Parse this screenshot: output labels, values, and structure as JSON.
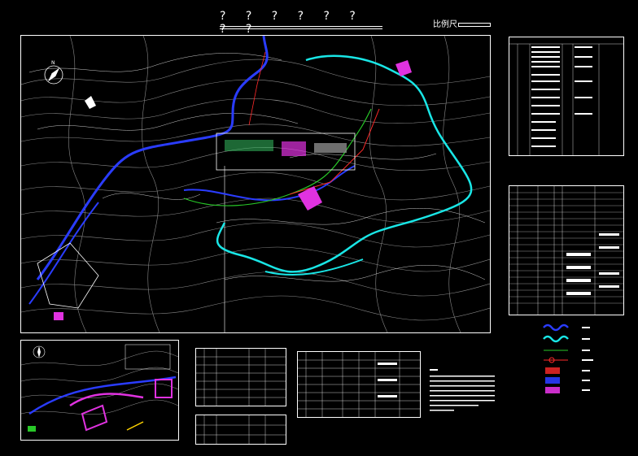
{
  "header": {
    "title": "? ? ? ? ? ? ? ?",
    "scale_label": "比例尺"
  },
  "main_map": {
    "compass_label": "N"
  },
  "inset_map": {
    "compass_label": "N"
  },
  "colors": {
    "road_blue": "#2a3cff",
    "road_cyan": "#19e6e6",
    "boundary_green": "#28c828",
    "red_line": "#ff2a2a",
    "magenta_fill": "#e032e0",
    "contour_white": "#ffffff",
    "contour_grey": "#8a8a8a",
    "background": "#000000"
  },
  "legend": {
    "items": [
      {
        "symbol": "blue-wave-line",
        "color": "#2a3cff"
      },
      {
        "symbol": "cyan-wave-line",
        "color": "#19e6e6"
      },
      {
        "symbol": "green-line",
        "color": "#28c828"
      },
      {
        "symbol": "red-circle-line",
        "color": "#ff2a2a"
      },
      {
        "symbol": "red-hatch-box",
        "color": "#ff2a2a"
      },
      {
        "symbol": "blue-hatch-box",
        "color": "#2a3cff"
      },
      {
        "symbol": "magenta-hatch-box",
        "color": "#e032e0"
      }
    ]
  }
}
